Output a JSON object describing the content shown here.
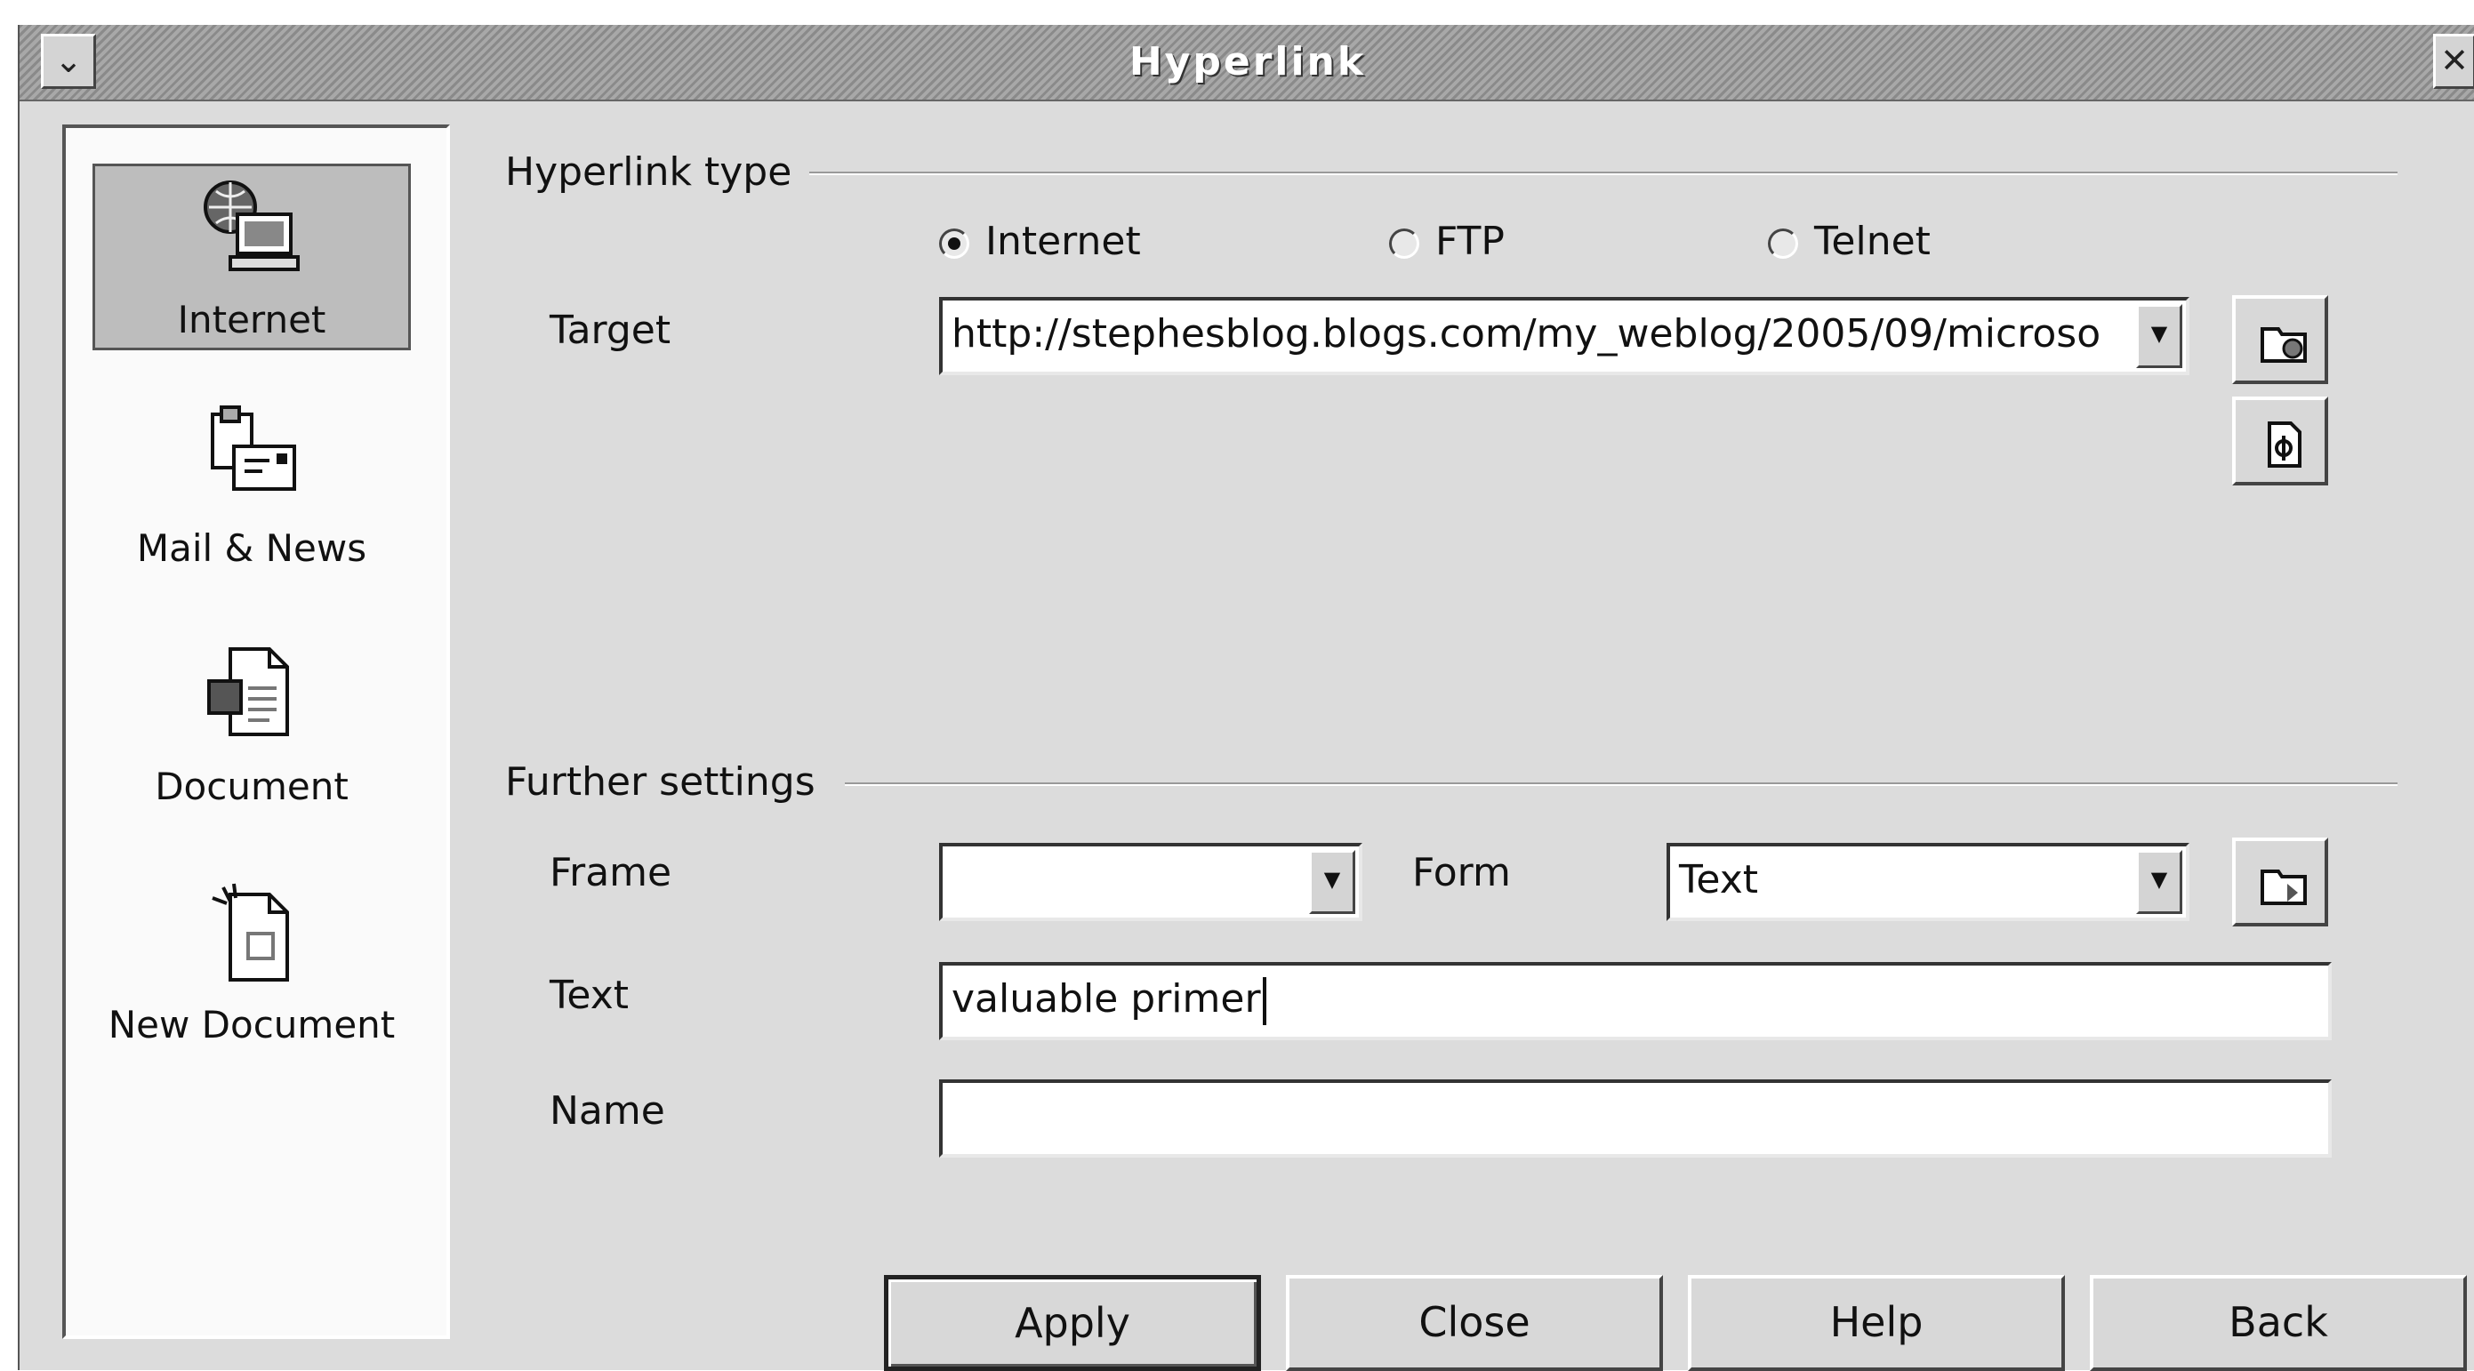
{
  "window": {
    "title": "Hyperlink",
    "menu_glyph": "⌄",
    "close_glyph": "✕"
  },
  "sidebar": {
    "items": [
      {
        "label": "Internet",
        "icon": "internet-icon",
        "selected": true
      },
      {
        "label": "Mail & News",
        "icon": "mail-news-icon",
        "selected": false
      },
      {
        "label": "Document",
        "icon": "document-icon",
        "selected": false
      },
      {
        "label": "New Document",
        "icon": "new-document-icon",
        "selected": false
      }
    ]
  },
  "hyperlink_type": {
    "title": "Hyperlink type",
    "options": [
      {
        "label": "Internet",
        "selected": true
      },
      {
        "label": "FTP",
        "selected": false
      },
      {
        "label": "Telnet",
        "selected": false
      }
    ],
    "target_label": "Target",
    "target_value": "http://stephesblog.blogs.com/my_weblog/2005/09/microso",
    "open_web_browser_icon": "open-web-browser-icon",
    "target_in_document_icon": "target-in-document-icon"
  },
  "further_settings": {
    "title": "Further settings",
    "frame_label": "Frame",
    "frame_value": "",
    "form_label": "Form",
    "form_value": "Text",
    "events_icon": "events-icon",
    "text_label": "Text",
    "text_value": "valuable primer",
    "name_label": "Name",
    "name_value": ""
  },
  "buttons": {
    "apply": "Apply",
    "close": "Close",
    "help": "Help",
    "back": "Back"
  }
}
